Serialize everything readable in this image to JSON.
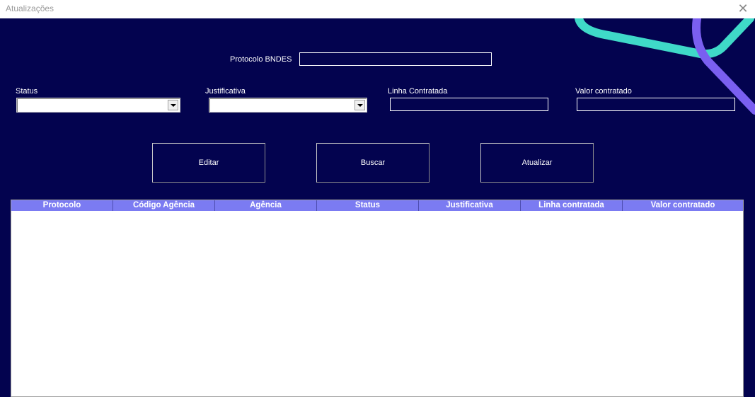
{
  "window": {
    "title": "Atualizações",
    "close_glyph": "✕"
  },
  "form": {
    "protocolo_label": "Protocolo BNDES",
    "protocolo_value": "",
    "status_label": "Status",
    "status_value": "",
    "justificativa_label": "Justificativa",
    "justificativa_value": "",
    "linha_label": "Linha Contratada",
    "linha_value": "",
    "valor_label": "Valor contratado",
    "valor_value": ""
  },
  "buttons": {
    "editar": "Editar",
    "buscar": "Buscar",
    "atualizar": "Atualizar"
  },
  "table": {
    "columns": [
      "Protocolo",
      "Código Agência",
      "Agência",
      "Status",
      "Justificativa",
      "Linha contratada",
      "Valor contratado"
    ],
    "rows": []
  },
  "colors": {
    "panel_bg": "#03034f",
    "header_bg": "#7b7bf2",
    "deco_teal": "#3fd9c8",
    "deco_purple": "#7a5ff0"
  }
}
